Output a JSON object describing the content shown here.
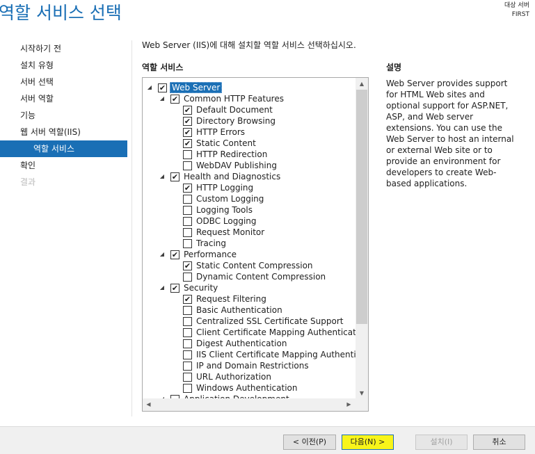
{
  "header": {
    "title": "역할 서비스 선택",
    "target_label": "대상 서버",
    "target_server": "FIRST"
  },
  "nav": {
    "items": [
      {
        "label": "시작하기 전",
        "state": "normal"
      },
      {
        "label": "설치 유형",
        "state": "normal"
      },
      {
        "label": "서버 선택",
        "state": "normal"
      },
      {
        "label": "서버 역할",
        "state": "normal"
      },
      {
        "label": "기능",
        "state": "normal"
      },
      {
        "label": "웹 서버 역할(IIS)",
        "state": "normal"
      },
      {
        "label": "역할 서비스",
        "state": "active"
      },
      {
        "label": "확인",
        "state": "normal"
      },
      {
        "label": "결과",
        "state": "disabled"
      }
    ]
  },
  "main": {
    "intro": "Web Server (IIS)에 대해 설치할 역할 서비스 선택하십시오.",
    "tree_header": "역할 서비스",
    "description_header": "설명",
    "description": "Web Server provides support for HTML Web sites and optional support for ASP.NET, ASP, and Web server extensions. You can use the Web Server to host an internal or external Web site or to provide an environment for developers to create Web-based applications."
  },
  "tree": [
    {
      "label": "Web Server",
      "level": 0,
      "checked": true,
      "expander": true,
      "selected": true
    },
    {
      "label": "Common HTTP Features",
      "level": 1,
      "checked": true,
      "expander": true
    },
    {
      "label": "Default Document",
      "level": 2,
      "checked": true
    },
    {
      "label": "Directory Browsing",
      "level": 2,
      "checked": true
    },
    {
      "label": "HTTP Errors",
      "level": 2,
      "checked": true
    },
    {
      "label": "Static Content",
      "level": 2,
      "checked": true
    },
    {
      "label": "HTTP Redirection",
      "level": 2,
      "checked": false
    },
    {
      "label": "WebDAV Publishing",
      "level": 2,
      "checked": false
    },
    {
      "label": "Health and Diagnostics",
      "level": 1,
      "checked": true,
      "expander": true
    },
    {
      "label": "HTTP Logging",
      "level": 2,
      "checked": true
    },
    {
      "label": "Custom Logging",
      "level": 2,
      "checked": false
    },
    {
      "label": "Logging Tools",
      "level": 2,
      "checked": false
    },
    {
      "label": "ODBC Logging",
      "level": 2,
      "checked": false
    },
    {
      "label": "Request Monitor",
      "level": 2,
      "checked": false
    },
    {
      "label": "Tracing",
      "level": 2,
      "checked": false
    },
    {
      "label": "Performance",
      "level": 1,
      "checked": true,
      "expander": true
    },
    {
      "label": "Static Content Compression",
      "level": 2,
      "checked": true
    },
    {
      "label": "Dynamic Content Compression",
      "level": 2,
      "checked": false
    },
    {
      "label": "Security",
      "level": 1,
      "checked": true,
      "expander": true
    },
    {
      "label": "Request Filtering",
      "level": 2,
      "checked": true
    },
    {
      "label": "Basic Authentication",
      "level": 2,
      "checked": false
    },
    {
      "label": "Centralized SSL Certificate Support",
      "level": 2,
      "checked": false
    },
    {
      "label": "Client Certificate Mapping Authentication",
      "level": 2,
      "checked": false
    },
    {
      "label": "Digest Authentication",
      "level": 2,
      "checked": false
    },
    {
      "label": "IIS Client Certificate Mapping Authenticat",
      "level": 2,
      "checked": false
    },
    {
      "label": "IP and Domain Restrictions",
      "level": 2,
      "checked": false
    },
    {
      "label": "URL Authorization",
      "level": 2,
      "checked": false
    },
    {
      "label": "Windows Authentication",
      "level": 2,
      "checked": false
    },
    {
      "label": "Application Development",
      "level": 1,
      "checked": false,
      "expander": true
    }
  ],
  "icons": {
    "check": "✔",
    "expand": "◢",
    "scroll_up": "▲",
    "scroll_down": "▼",
    "scroll_left": "◀",
    "scroll_right": "▶"
  },
  "footer": {
    "prev_label": "< 이전(P)",
    "next_label": "다음(N) >",
    "install_label": "설치(I)",
    "cancel_label": "취소"
  },
  "colors": {
    "accent": "#1a6fb5",
    "highlight": "#f8f51a"
  }
}
